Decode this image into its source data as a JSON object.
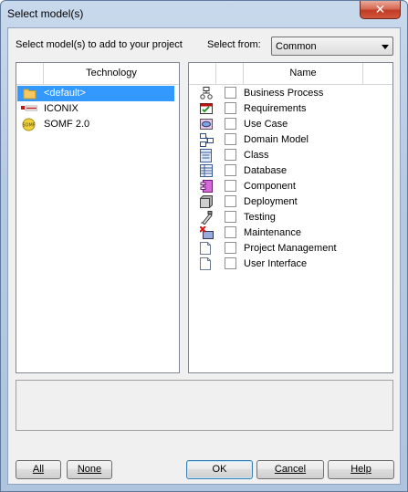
{
  "window": {
    "title": "Select model(s)",
    "close_glyph": "✕"
  },
  "instruction": "Select model(s) to add to your project",
  "select_from": {
    "label": "Select from:",
    "value": "Common"
  },
  "technology": {
    "header": "Technology",
    "items": [
      {
        "label": "<default>",
        "icon": "folder-icon",
        "selected": true
      },
      {
        "label": "ICONIX",
        "icon": "iconix-logo-icon",
        "selected": false
      },
      {
        "label": "SOMF 2.0",
        "icon": "somf-logo-icon",
        "selected": false
      }
    ]
  },
  "models": {
    "header": "Name",
    "items": [
      {
        "label": "Business Process",
        "icon": "business-process-icon"
      },
      {
        "label": "Requirements",
        "icon": "requirements-icon"
      },
      {
        "label": "Use Case",
        "icon": "use-case-icon"
      },
      {
        "label": "Domain Model",
        "icon": "domain-model-icon"
      },
      {
        "label": "Class",
        "icon": "class-icon"
      },
      {
        "label": "Database",
        "icon": "database-icon"
      },
      {
        "label": "Component",
        "icon": "component-icon"
      },
      {
        "label": "Deployment",
        "icon": "deployment-icon"
      },
      {
        "label": "Testing",
        "icon": "testing-icon"
      },
      {
        "label": "Maintenance",
        "icon": "maintenance-icon"
      },
      {
        "label": "Project Management",
        "icon": "document-icon"
      },
      {
        "label": "User Interface",
        "icon": "document-icon"
      }
    ]
  },
  "buttons": {
    "all": "All",
    "none": "None",
    "ok": "OK",
    "cancel": "Cancel",
    "help": "Help"
  },
  "colors": {
    "selection": "#3399ff",
    "close": "#c13c24"
  }
}
